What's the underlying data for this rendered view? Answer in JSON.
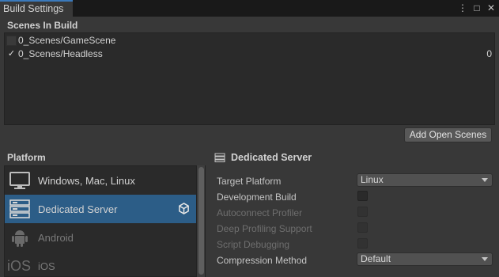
{
  "window": {
    "tab_title": "Build Settings",
    "controls": [
      "⋮",
      "□",
      "✕"
    ]
  },
  "scenes": {
    "label": "Scenes In Build",
    "items": [
      {
        "name": "0_Scenes/GameScene",
        "checked": false,
        "index": ""
      },
      {
        "name": "0_Scenes/Headless",
        "checked": true,
        "index": "0"
      }
    ],
    "add_open_scenes_label": "Add Open Scenes"
  },
  "platform": {
    "label": "Platform",
    "items": [
      {
        "label": "Windows, Mac, Linux",
        "icon": "monitor-icon",
        "selected": false,
        "disabled": false
      },
      {
        "label": "Dedicated Server",
        "icon": "server-icon",
        "selected": true,
        "disabled": false,
        "active_icon": "unity-logo-icon"
      },
      {
        "label": "Android",
        "icon": "android-icon",
        "selected": false,
        "disabled": true
      },
      {
        "label": "iOS",
        "icon": "ios-icon",
        "icon_text": "iOS",
        "selected": false,
        "disabled": true
      }
    ]
  },
  "settings": {
    "title": "Dedicated Server",
    "target_platform": {
      "label": "Target Platform",
      "value": "Linux"
    },
    "development_build": {
      "label": "Development Build",
      "checked": false
    },
    "autoconnect_profiler": {
      "label": "Autoconnect Profiler",
      "checked": false,
      "disabled": true
    },
    "deep_profiling": {
      "label": "Deep Profiling Support",
      "checked": false,
      "disabled": true
    },
    "script_debugging": {
      "label": "Script Debugging",
      "checked": false,
      "disabled": true
    },
    "compression_method": {
      "label": "Compression Method",
      "value": "Default"
    }
  },
  "colors": {
    "background": "#383838",
    "selected": "#2c5d87",
    "tab_accent": "#3a79bb"
  }
}
